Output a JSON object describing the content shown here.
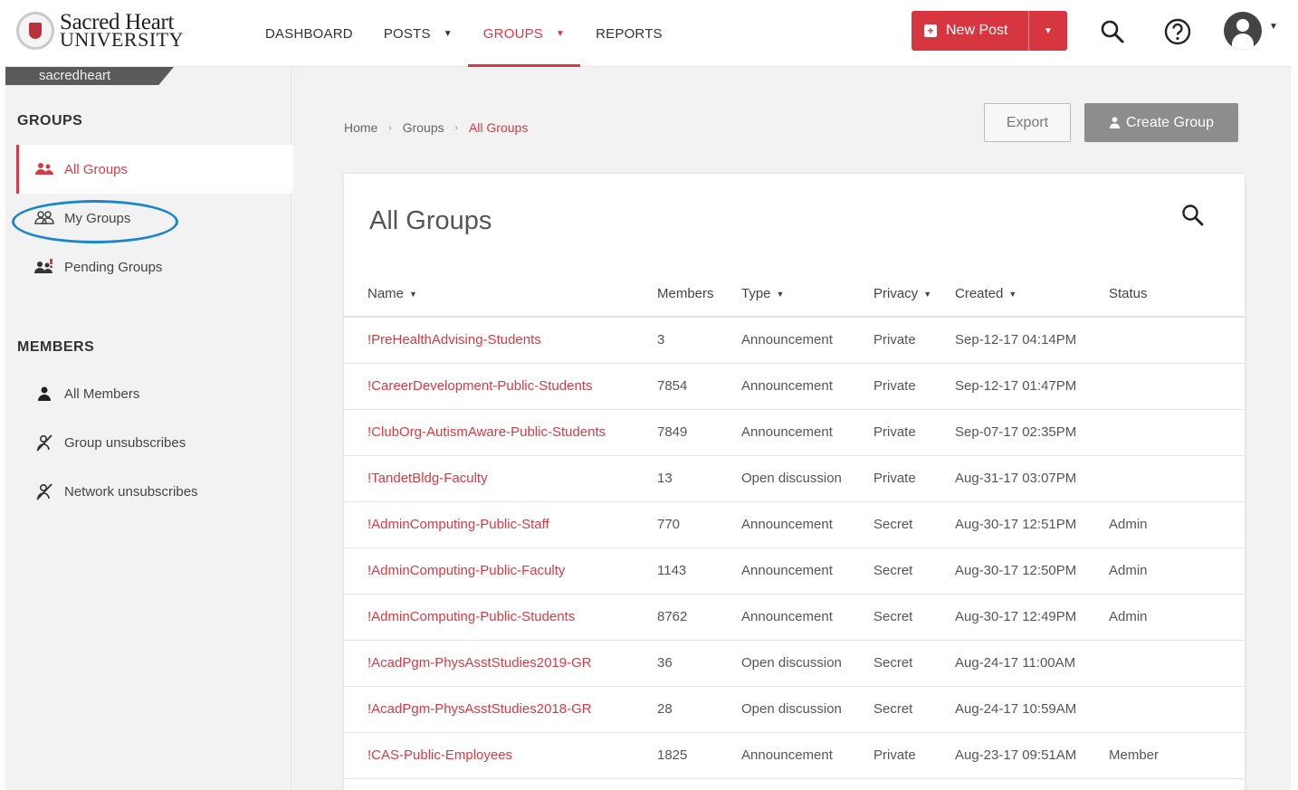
{
  "logo": {
    "line1": "Sacred Heart",
    "line2": "UNIVERSITY"
  },
  "nav": [
    {
      "label": "DASHBOARD",
      "caret": false,
      "active": false
    },
    {
      "label": "POSTS",
      "caret": true,
      "active": false
    },
    {
      "label": "GROUPS",
      "caret": true,
      "active": true
    },
    {
      "label": "REPORTS",
      "caret": false,
      "active": false
    }
  ],
  "header": {
    "new_post_label": "New Post"
  },
  "colors": {
    "accent": "#d53b44",
    "button_red": "#d6363f",
    "highlight_circle": "#1b86c9"
  },
  "sidebar": {
    "tenant": "sacredheart",
    "groups_title": "GROUPS",
    "groups_items": [
      {
        "label": "All Groups",
        "icon": "groups-icon",
        "active": true
      },
      {
        "label": "My Groups",
        "icon": "my-groups-icon",
        "active": false
      },
      {
        "label": "Pending Groups",
        "icon": "pending-groups-icon",
        "active": false
      }
    ],
    "members_title": "MEMBERS",
    "members_items": [
      {
        "label": "All Members",
        "icon": "user-icon"
      },
      {
        "label": "Group unsubscribes",
        "icon": "unsubscribe-icon"
      },
      {
        "label": "Network unsubscribes",
        "icon": "unsubscribe-icon"
      }
    ]
  },
  "breadcrumb": {
    "home": "Home",
    "groups": "Groups",
    "current": "All Groups"
  },
  "toolbar": {
    "export_label": "Export",
    "create_label": "Create Group"
  },
  "card": {
    "title": "All Groups"
  },
  "table": {
    "columns": [
      "Name",
      "Members",
      "Type",
      "Privacy",
      "Created",
      "Status"
    ],
    "rows": [
      {
        "name": "!PreHealthAdvising-Students",
        "members": "3",
        "type": "Announcement",
        "privacy": "Private",
        "created": "Sep-12-17 04:14PM",
        "status": ""
      },
      {
        "name": "!CareerDevelopment-Public-Students",
        "members": "7854",
        "type": "Announcement",
        "privacy": "Private",
        "created": "Sep-12-17 01:47PM",
        "status": ""
      },
      {
        "name": "!ClubOrg-AutismAware-Public-Students",
        "members": "7849",
        "type": "Announcement",
        "privacy": "Private",
        "created": "Sep-07-17 02:35PM",
        "status": ""
      },
      {
        "name": "!TandetBldg-Faculty",
        "members": "13",
        "type": "Open discussion",
        "privacy": "Private",
        "created": "Aug-31-17 03:07PM",
        "status": ""
      },
      {
        "name": "!AdminComputing-Public-Staff",
        "members": "770",
        "type": "Announcement",
        "privacy": "Secret",
        "created": "Aug-30-17 12:51PM",
        "status": "Admin"
      },
      {
        "name": "!AdminComputing-Public-Faculty",
        "members": "1143",
        "type": "Announcement",
        "privacy": "Secret",
        "created": "Aug-30-17 12:50PM",
        "status": "Admin"
      },
      {
        "name": "!AdminComputing-Public-Students",
        "members": "8762",
        "type": "Announcement",
        "privacy": "Secret",
        "created": "Aug-30-17 12:49PM",
        "status": "Admin"
      },
      {
        "name": "!AcadPgm-PhysAsstStudies2019-GR",
        "members": "36",
        "type": "Open discussion",
        "privacy": "Secret",
        "created": "Aug-24-17 11:00AM",
        "status": ""
      },
      {
        "name": "!AcadPgm-PhysAsstStudies2018-GR",
        "members": "28",
        "type": "Open discussion",
        "privacy": "Secret",
        "created": "Aug-24-17 10:59AM",
        "status": ""
      },
      {
        "name": "!CAS-Public-Employees",
        "members": "1825",
        "type": "Announcement",
        "privacy": "Private",
        "created": "Aug-23-17 09:51AM",
        "status": "Member"
      }
    ]
  }
}
